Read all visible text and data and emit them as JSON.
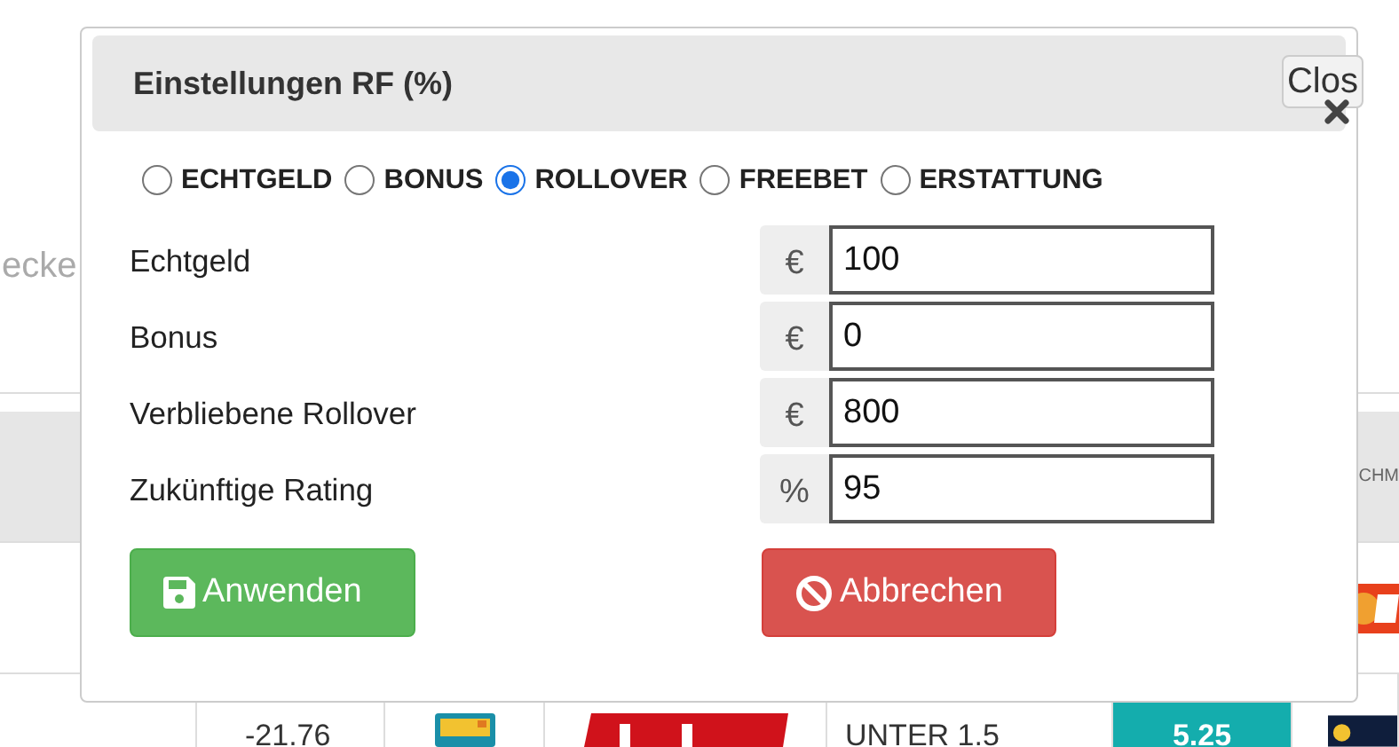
{
  "background": {
    "search_text": "ecke",
    "header_text": "CHM",
    "row": {
      "value": "-21.76",
      "market": "UNTER 1.5",
      "odds": "5.25"
    }
  },
  "modal": {
    "title": "Einstellungen RF (%)",
    "close_label": "Clos",
    "bet_types": [
      {
        "label": "ECHTGELD",
        "selected": false
      },
      {
        "label": "BONUS",
        "selected": false
      },
      {
        "label": "ROLLOVER",
        "selected": true
      },
      {
        "label": "FREEBET",
        "selected": false
      },
      {
        "label": "ERSTATTUNG",
        "selected": false
      }
    ],
    "fields": [
      {
        "label": "Echtgeld",
        "unit": "€",
        "value": "100"
      },
      {
        "label": "Bonus",
        "unit": "€",
        "value": "0"
      },
      {
        "label": "Verbliebene Rollover",
        "unit": "€",
        "value": "800"
      },
      {
        "label": "Zukünftige Rating",
        "unit": "%",
        "value": "95"
      }
    ],
    "buttons": [
      {
        "label": "Anwenden",
        "kind": "apply"
      },
      {
        "label": "Abbrechen",
        "kind": "cancel"
      }
    ]
  }
}
